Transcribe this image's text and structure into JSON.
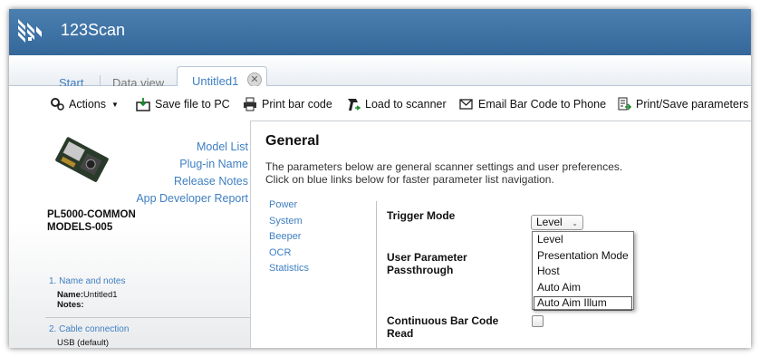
{
  "app": {
    "title": "123Scan",
    "accent": "#3a6d9f"
  },
  "tabs": [
    {
      "label": "Start"
    },
    {
      "label": "Data view"
    },
    {
      "label": "Untitled1",
      "active": true
    }
  ],
  "toolbar": {
    "actions": "Actions",
    "save": "Save file to PC",
    "print": "Print bar code",
    "load": "Load to scanner",
    "email": "Email Bar Code to Phone",
    "printsave": "Print/Save parameters"
  },
  "left": {
    "links": [
      "Model List",
      "Plug-in Name",
      "Release Notes",
      "App Developer Report"
    ],
    "model_line1": "PL5000-COMMON",
    "model_line2": "MODELS-005",
    "step1": {
      "title": "1.  Name and notes",
      "name_label": "Name:",
      "name_value": "Untitled1",
      "notes_label": "Notes:"
    },
    "step2": {
      "title": "2.  Cable connection",
      "value": "USB (default)"
    }
  },
  "main": {
    "heading": "General",
    "desc1": "The parameters below are general scanner settings and user preferences.",
    "desc2": "Click on blue links below for faster parameter list navigation.",
    "nav": [
      "Power",
      "System",
      "Beeper",
      "OCR",
      "Statistics"
    ],
    "params": {
      "trigger": "Trigger Mode",
      "upp1": "User Parameter",
      "upp2": "Passthrough",
      "cbr1": "Continuous Bar Code",
      "cbr2": "Read"
    },
    "trigger_select": {
      "value": "Level"
    },
    "trigger_options": [
      "Level",
      "Presentation Mode",
      "Host",
      "Auto Aim",
      "Auto Aim Illum"
    ],
    "continuous_checked": false
  }
}
